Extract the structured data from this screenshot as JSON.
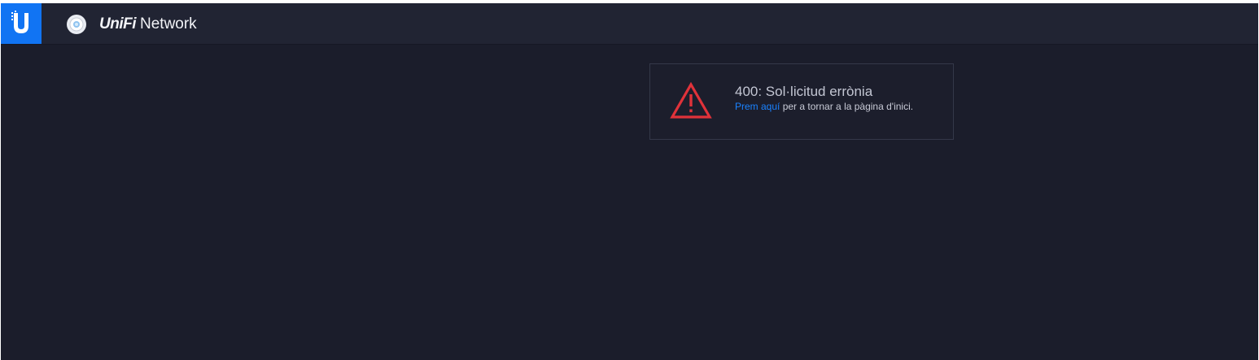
{
  "app": {
    "brand": "UniFi",
    "product": "Network",
    "logo_icon": "ubiquiti-u-logo-icon",
    "app_icon": "unifi-access-point-icon"
  },
  "colors": {
    "accent": "#1174f3",
    "background": "#1b1d2b",
    "header": "#212433",
    "error_red": "#e0323a",
    "link": "#1a82ff"
  },
  "error": {
    "icon": "warning-triangle-icon",
    "title": "400: Sol·licitud errònia",
    "link_label": "Prem aquí",
    "message_suffix": " per a tornar a la pàgina d'inici."
  }
}
